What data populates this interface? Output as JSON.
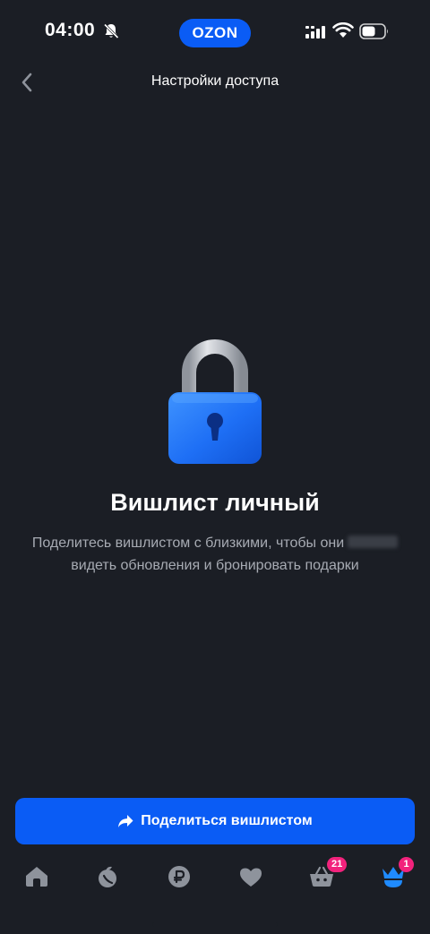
{
  "status_bar": {
    "time": "04:00",
    "brand_logo_text": "OZON",
    "icons": [
      "bell-off-icon",
      "cellular-signal-icon",
      "wifi-icon",
      "battery-icon"
    ]
  },
  "header": {
    "title": "Настройки доступа",
    "back_icon": "chevron-left-icon"
  },
  "empty_state": {
    "illustration": "padlock-icon",
    "title": "Вишлист личный",
    "description_line1": "Поделитесь вишлистом с близкими, чтобы они",
    "description_line2": "видеть обновления и бронировать подарки"
  },
  "share_button": {
    "label": "Поделиться вишлистом",
    "icon": "share-arrow-icon"
  },
  "tab_bar": {
    "items": [
      {
        "icon": "home-icon"
      },
      {
        "icon": "fresh-apple-icon"
      },
      {
        "icon": "ruble-icon"
      },
      {
        "icon": "heart-icon"
      },
      {
        "icon": "basket-icon",
        "badge": "21"
      },
      {
        "icon": "crown-profile-icon",
        "badge": "1",
        "active": true
      }
    ]
  },
  "colors": {
    "background": "#1b1e25",
    "accent": "#0a5cf5",
    "badge": "#f2227c",
    "tab_icon": "#8e939c",
    "secondary_text": "#a7abb3"
  }
}
